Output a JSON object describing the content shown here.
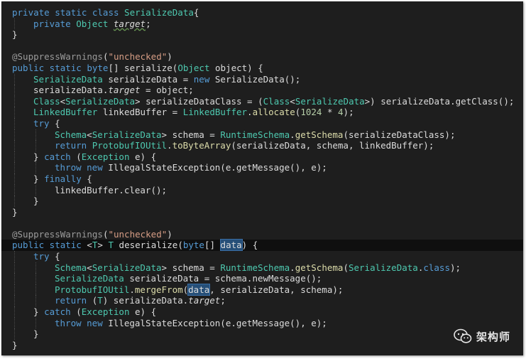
{
  "colors": {
    "background": "#1e1e1e",
    "keyword": "#569cd6",
    "type": "#4ec9b0",
    "method": "#dcdcaa",
    "string": "#d69d85",
    "number": "#b5cea8",
    "annotation": "#9b9b9b",
    "plain": "#dcdcdc",
    "highlight": "#264f78"
  },
  "watermark": {
    "icon": "wechat-icon",
    "label": "架构师"
  },
  "code": {
    "lines": [
      {
        "indent": 0,
        "tokens": [
          [
            "kw",
            "private static class "
          ],
          [
            "type",
            "SerializeData"
          ],
          [
            "p",
            "{"
          ]
        ]
      },
      {
        "indent": 1,
        "tokens": [
          [
            "kw",
            "private "
          ],
          [
            "type",
            "Object "
          ],
          [
            "fld-sq",
            "target"
          ],
          [
            "p",
            ";"
          ]
        ]
      },
      {
        "indent": 0,
        "tokens": [
          [
            "p",
            "}"
          ]
        ]
      },
      {
        "indent": 0,
        "tokens": []
      },
      {
        "indent": 0,
        "tokens": [
          [
            "ann",
            "@SuppressWarnings"
          ],
          [
            "p",
            "("
          ],
          [
            "str",
            "\"unchecked\""
          ],
          [
            "p",
            ")"
          ]
        ]
      },
      {
        "indent": 0,
        "tokens": [
          [
            "kw",
            "public static byte"
          ],
          [
            "p",
            "[] serialize("
          ],
          [
            "type",
            "Object"
          ],
          [
            "p",
            " object) {"
          ]
        ]
      },
      {
        "indent": 1,
        "tokens": [
          [
            "type",
            "SerializeData"
          ],
          [
            "p",
            " serializeData = "
          ],
          [
            "kw",
            "new "
          ],
          [
            "p",
            "SerializeData();"
          ]
        ]
      },
      {
        "indent": 1,
        "tokens": [
          [
            "p",
            "serializeData."
          ],
          [
            "fld",
            "target"
          ],
          [
            "p",
            " = object;"
          ]
        ]
      },
      {
        "indent": 1,
        "tokens": [
          [
            "type",
            "Class"
          ],
          [
            "p",
            "<"
          ],
          [
            "type",
            "SerializeData"
          ],
          [
            "p",
            "> serializeDataClass = ("
          ],
          [
            "type",
            "Class"
          ],
          [
            "p",
            "<"
          ],
          [
            "type",
            "SerializeData"
          ],
          [
            "p",
            ">) serializeData.getClass();"
          ]
        ]
      },
      {
        "indent": 1,
        "tokens": [
          [
            "type",
            "LinkedBuffer"
          ],
          [
            "p",
            " linkedBuffer = "
          ],
          [
            "type",
            "LinkedBuffer"
          ],
          [
            "p",
            "."
          ],
          [
            "fn",
            "allocate"
          ],
          [
            "p",
            "("
          ],
          [
            "num",
            "1024"
          ],
          [
            "p",
            " * "
          ],
          [
            "num",
            "4"
          ],
          [
            "p",
            ");"
          ]
        ]
      },
      {
        "indent": 1,
        "tokens": [
          [
            "kw",
            "try "
          ],
          [
            "p",
            "{"
          ]
        ]
      },
      {
        "indent": 2,
        "tokens": [
          [
            "type",
            "Schema"
          ],
          [
            "p",
            "<"
          ],
          [
            "type",
            "SerializeData"
          ],
          [
            "p",
            "> schema = "
          ],
          [
            "type",
            "RuntimeSchema"
          ],
          [
            "p",
            "."
          ],
          [
            "fn",
            "getSchema"
          ],
          [
            "p",
            "(serializeDataClass);"
          ]
        ]
      },
      {
        "indent": 2,
        "tokens": [
          [
            "kw",
            "return "
          ],
          [
            "type",
            "ProtobufIOUtil"
          ],
          [
            "p",
            "."
          ],
          [
            "fn",
            "toByteArray"
          ],
          [
            "p",
            "(serializeData, schema, linkedBuffer);"
          ]
        ]
      },
      {
        "indent": 1,
        "tokens": [
          [
            "p",
            "} "
          ],
          [
            "kw",
            "catch "
          ],
          [
            "p",
            "("
          ],
          [
            "type",
            "Exception"
          ],
          [
            "p",
            " e) {"
          ]
        ]
      },
      {
        "indent": 2,
        "tokens": [
          [
            "kw",
            "throw new "
          ],
          [
            "p",
            "IllegalStateException(e.getMessage(), e);"
          ]
        ]
      },
      {
        "indent": 1,
        "tokens": [
          [
            "p",
            "} "
          ],
          [
            "kw",
            "finally "
          ],
          [
            "p",
            "{"
          ]
        ]
      },
      {
        "indent": 2,
        "tokens": [
          [
            "p",
            "linkedBuffer.clear();"
          ]
        ]
      },
      {
        "indent": 1,
        "tokens": [
          [
            "p",
            "}"
          ]
        ]
      },
      {
        "indent": 0,
        "tokens": [
          [
            "p",
            "}"
          ]
        ]
      },
      {
        "indent": 0,
        "tokens": []
      },
      {
        "indent": 0,
        "tokens": [
          [
            "ann",
            "@SuppressWarnings"
          ],
          [
            "p",
            "("
          ],
          [
            "str",
            "\"unchecked\""
          ],
          [
            "p",
            ")"
          ]
        ]
      },
      {
        "indent": 0,
        "current": true,
        "tokens": [
          [
            "kw",
            "public static "
          ],
          [
            "p",
            "<"
          ],
          [
            "type",
            "T"
          ],
          [
            "p",
            "> "
          ],
          [
            "type",
            "T"
          ],
          [
            "p",
            " deserialize("
          ],
          [
            "kw",
            "byte"
          ],
          [
            "p",
            "[] "
          ],
          [
            "hl",
            "data"
          ],
          [
            "p",
            ") {"
          ]
        ]
      },
      {
        "indent": 1,
        "tokens": [
          [
            "kw",
            "try "
          ],
          [
            "p",
            "{"
          ]
        ]
      },
      {
        "indent": 2,
        "tokens": [
          [
            "type",
            "Schema"
          ],
          [
            "p",
            "<"
          ],
          [
            "type",
            "SerializeData"
          ],
          [
            "p",
            "> schema = "
          ],
          [
            "type",
            "RuntimeSchema"
          ],
          [
            "p",
            "."
          ],
          [
            "fn",
            "getSchema"
          ],
          [
            "p",
            "("
          ],
          [
            "type",
            "SerializeData"
          ],
          [
            "p",
            "."
          ],
          [
            "kw",
            "class"
          ],
          [
            "p",
            ");"
          ]
        ]
      },
      {
        "indent": 2,
        "tokens": [
          [
            "type",
            "SerializeData"
          ],
          [
            "p",
            " serializeData = schema.newMessage();"
          ]
        ]
      },
      {
        "indent": 2,
        "tokens": [
          [
            "type",
            "ProtobufIOUtil"
          ],
          [
            "p",
            "."
          ],
          [
            "fn",
            "mergeFrom"
          ],
          [
            "p",
            "("
          ],
          [
            "hl",
            "data"
          ],
          [
            "p",
            ", serializeData, schema);"
          ]
        ]
      },
      {
        "indent": 2,
        "tokens": [
          [
            "kw",
            "return "
          ],
          [
            "p",
            "("
          ],
          [
            "type",
            "T"
          ],
          [
            "p",
            ") serializeData."
          ],
          [
            "fld",
            "target"
          ],
          [
            "p",
            ";"
          ]
        ]
      },
      {
        "indent": 1,
        "tokens": [
          [
            "p",
            "} "
          ],
          [
            "kw",
            "catch "
          ],
          [
            "p",
            "("
          ],
          [
            "type",
            "Exception"
          ],
          [
            "p",
            " e) {"
          ]
        ]
      },
      {
        "indent": 2,
        "tokens": [
          [
            "kw",
            "throw new "
          ],
          [
            "p",
            "IllegalStateException(e.getMessage(), e);"
          ]
        ]
      },
      {
        "indent": 1,
        "tokens": [
          [
            "p",
            "}"
          ]
        ]
      },
      {
        "indent": 0,
        "tokens": [
          [
            "p",
            "}"
          ]
        ]
      }
    ]
  }
}
